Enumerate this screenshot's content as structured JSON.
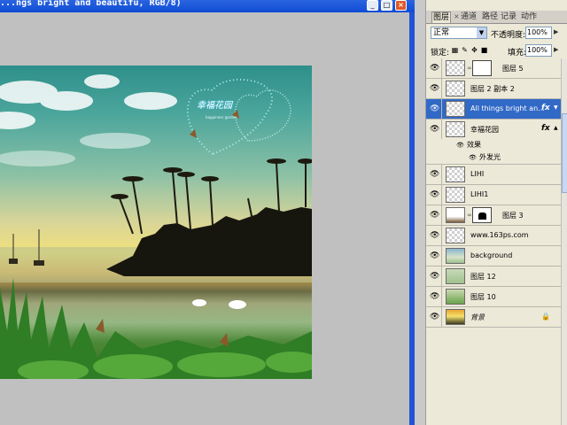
{
  "window": {
    "title": "...ngs bright and beautifu, RGB/8)",
    "min": "_",
    "max": "□",
    "close": "×"
  },
  "photo": {
    "watermark": "幸福花园",
    "small_text": "happiness garden"
  },
  "panel": {
    "tabs": [
      "图层",
      "×",
      "通道",
      "路径",
      "记录",
      "动作"
    ],
    "blend_mode": "正常",
    "opacity_label": "不透明度:",
    "opacity": "100%",
    "lock_label": "锁定:",
    "fill_label": "填充:",
    "fill": "100%"
  },
  "icons": [
    "eye-icon",
    "chain-icon",
    "fx-icon",
    "lock-icon",
    "dropdown-arrow-icon"
  ],
  "layers": [
    {
      "name": "图层 5"
    },
    {
      "name": "图层 2 副本 2"
    },
    {
      "name": "All things bright an...",
      "fx": "fx",
      "selected": true
    },
    {
      "name": "幸福花园",
      "fx": "fx"
    },
    {
      "name": "效果"
    },
    {
      "name": "外发光"
    },
    {
      "name": "LIHI"
    },
    {
      "name": "LIHI1"
    },
    {
      "name": "图层 3"
    },
    {
      "name": "www.163ps.com"
    },
    {
      "name": "background"
    },
    {
      "name": "图层 12"
    },
    {
      "name": "图层 10"
    },
    {
      "name": "背景"
    }
  ]
}
